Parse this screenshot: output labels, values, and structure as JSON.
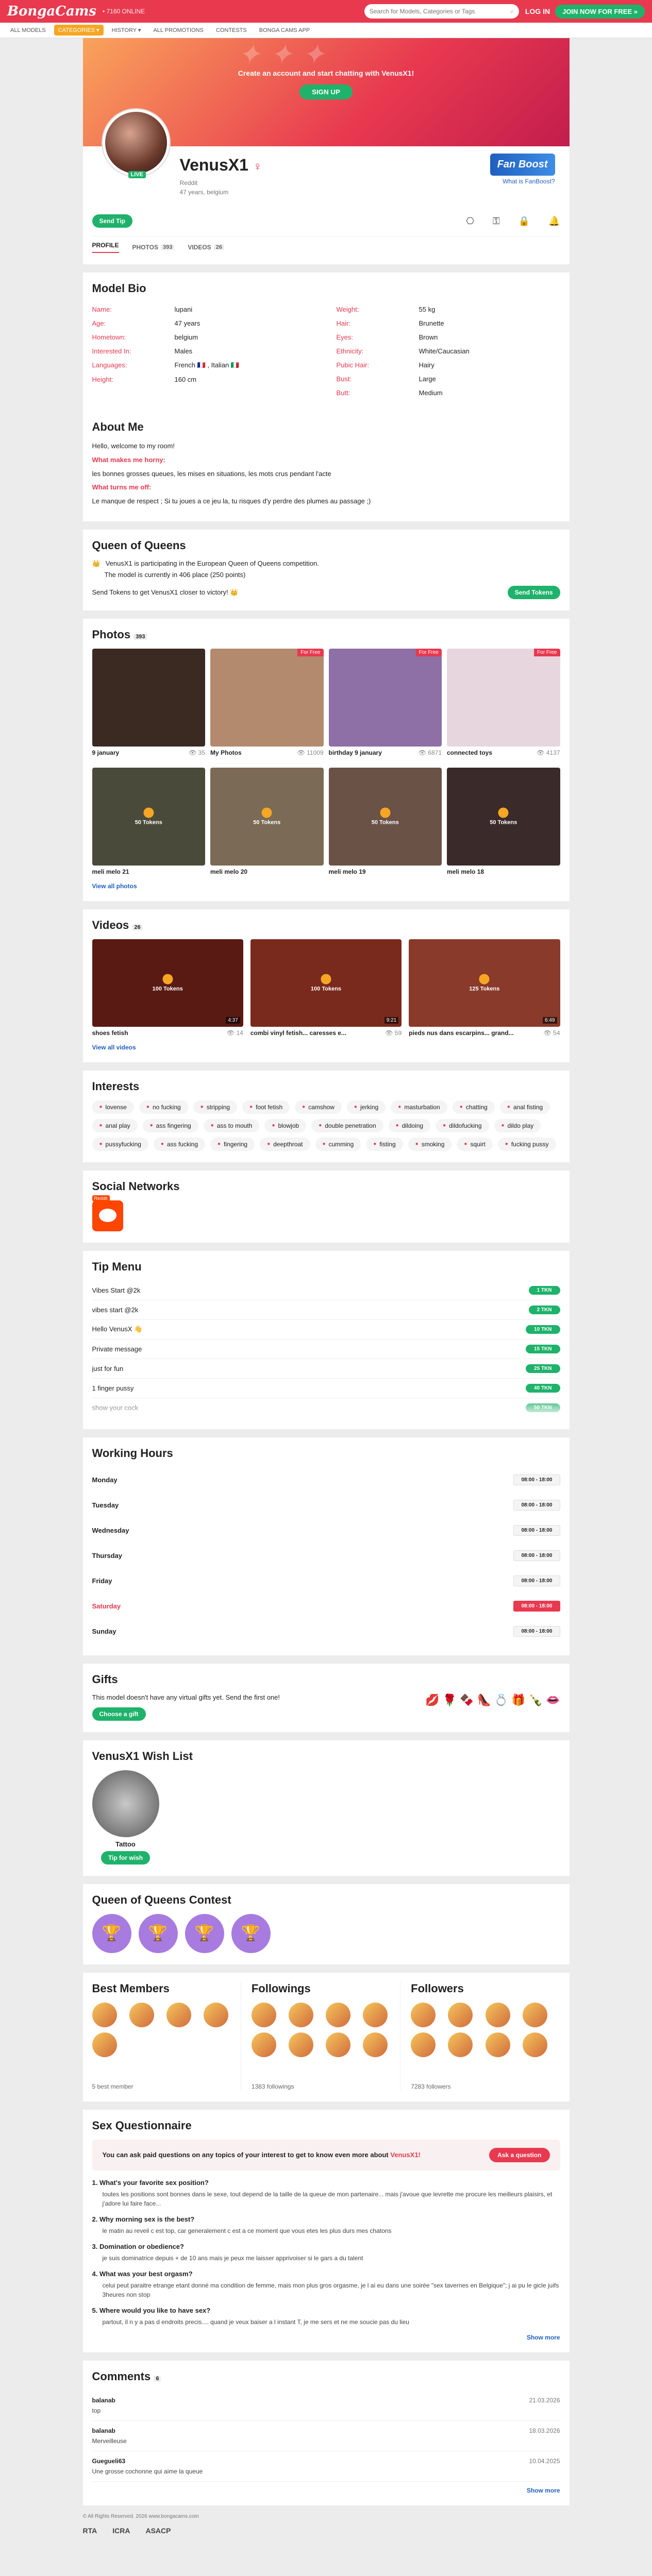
{
  "header": {
    "logo": "BongaCams",
    "online": "• 7160 ONLINE",
    "search_placeholder": "Search for Models, Categories or Tags",
    "login": "LOG IN",
    "join": "JOIN NOW FOR FREE »"
  },
  "nav": [
    "ALL MODELS",
    "CATEGORIES ▾",
    "HISTORY ▾",
    "ALL PROMOTIONS",
    "CONTESTS",
    "BONGA CAMS APP"
  ],
  "banner": {
    "text": "Create an account and start chatting with VenusX1!",
    "signup": "SIGN UP"
  },
  "profile": {
    "name": "VenusX1",
    "sign": "♀",
    "status": "Reddit",
    "meta": "47 years, belgium",
    "live": "LIVE",
    "fanboost": "Fan Boost",
    "fanboost_link": "What is FanBoost?",
    "send_tip": "Send Tip",
    "tabs": [
      {
        "label": "PROFILE",
        "count": ""
      },
      {
        "label": "PHOTOS",
        "count": "393"
      },
      {
        "label": "VIDEOS",
        "count": "26"
      }
    ]
  },
  "bio": {
    "title": "Model Bio",
    "left": [
      {
        "label": "Name:",
        "value": "lupani"
      },
      {
        "label": "Age:",
        "value": "47 years"
      },
      {
        "label": "Hometown:",
        "value": "belgium"
      },
      {
        "label": "Interested In:",
        "value": "Males"
      },
      {
        "label": "Languages:",
        "value": "French 🇫🇷 , Italian 🇮🇹"
      },
      {
        "label": "Height:",
        "value": "160 cm"
      }
    ],
    "right": [
      {
        "label": "Weight:",
        "value": "55 kg"
      },
      {
        "label": "Hair:",
        "value": "Brunette"
      },
      {
        "label": "Eyes:",
        "value": "Brown"
      },
      {
        "label": "Ethnicity:",
        "value": "White/Caucasian"
      },
      {
        "label": "Pubic Hair:",
        "value": "Hairy"
      },
      {
        "label": "Bust:",
        "value": "Large"
      },
      {
        "label": "Butt:",
        "value": "Medium"
      }
    ]
  },
  "about": {
    "title": "About Me",
    "intro": "Hello, welcome to my room!",
    "q1": "What makes me horny:",
    "a1": "les bonnes grosses queues, les mises en situations, les mots crus pendant l'acte",
    "q2": "What turns me off:",
    "a2": "Le manque de respect ; Si tu joues a ce jeu la, tu risques d'y perdre des plumes au passage ;)"
  },
  "qoq": {
    "title": "Queen of Queens",
    "line1": "VenusX1 is participating in the European Queen of Queens competition.",
    "line2": "The model is currently in 406 place (250 points)",
    "foot": "Send Tokens to get VenusX1 closer to victory! 👑",
    "button": "Send Tokens"
  },
  "photos": {
    "title": "Photos",
    "count": "393",
    "view_all": "View all photos",
    "items": [
      {
        "title": "9 january",
        "views": "35",
        "free": "",
        "token": "",
        "color": "#3a2a22"
      },
      {
        "title": "My Photos",
        "views": "11009",
        "free": "For Free",
        "token": "",
        "color": "#b38a6e"
      },
      {
        "title": "birthday 9 january",
        "views": "6871",
        "free": "For Free",
        "token": "",
        "color": "#8e6fa6"
      },
      {
        "title": "connected toys",
        "views": "4137",
        "free": "For Free",
        "token": "",
        "color": "#e7d6de"
      },
      {
        "title": "meli melo 21",
        "views": "",
        "free": "",
        "token": "50 Tokens",
        "color": "#4a4a3a"
      },
      {
        "title": "meli melo 20",
        "views": "",
        "free": "",
        "token": "50 Tokens",
        "color": "#7b6a55"
      },
      {
        "title": "meli melo 19",
        "views": "",
        "free": "",
        "token": "50 Tokens",
        "color": "#6a5247"
      },
      {
        "title": "meli melo 18",
        "views": "",
        "free": "",
        "token": "50 Tokens",
        "color": "#3b2a2a"
      }
    ]
  },
  "videos": {
    "title": "Videos",
    "count": "26",
    "view_all": "View all videos",
    "items": [
      {
        "title": "shoes fetish",
        "views": "14",
        "token": "100 Tokens",
        "dur": "4:37",
        "color": "#5a1a14"
      },
      {
        "title": "combi vinyl fetish... caresses e...",
        "views": "59",
        "token": "100 Tokens",
        "dur": "9:21",
        "color": "#7a2a1c"
      },
      {
        "title": "pieds nus dans escarpins... grand...",
        "views": "54",
        "token": "125 Tokens",
        "dur": "6:49",
        "color": "#8a3a2a"
      }
    ]
  },
  "interests": {
    "title": "Interests",
    "items": [
      "lovense",
      "no fucking",
      "stripping",
      "foot fetish",
      "camshow",
      "jerking",
      "masturbation",
      "chatting",
      "anal fisting",
      "anal play",
      "ass fingering",
      "ass to mouth",
      "blowjob",
      "double penetration",
      "dildoing",
      "dildofucking",
      "dildo play",
      "pussyfucking",
      "ass fucking",
      "fingering",
      "deepthroat",
      "cumming",
      "fisting",
      "smoking",
      "squirt",
      "fucking pussy"
    ]
  },
  "social": {
    "title": "Social Networks",
    "label": "Reddit"
  },
  "tips": {
    "title": "Tip Menu",
    "items": [
      {
        "label": "Vibes Start @2k",
        "price": "1 TKN"
      },
      {
        "label": "vibes start @2k",
        "price": "2 TKN"
      },
      {
        "label": "Hello VenusX 👋",
        "price": "10 TKN"
      },
      {
        "label": "Private message",
        "price": "15 TKN"
      },
      {
        "label": "just for fun",
        "price": "25 TKN"
      },
      {
        "label": "1 finger pussy",
        "price": "40 TKN"
      },
      {
        "label": "show your cock",
        "price": "50 TKN"
      }
    ]
  },
  "hours": {
    "title": "Working Hours",
    "items": [
      {
        "day": "Monday",
        "time": "08:00 - 18:00"
      },
      {
        "day": "Tuesday",
        "time": "08:00 - 18:00"
      },
      {
        "day": "Wednesday",
        "time": "08:00 - 18:00"
      },
      {
        "day": "Thursday",
        "time": "08:00 - 18:00"
      },
      {
        "day": "Friday",
        "time": "08:00 - 18:00"
      },
      {
        "day": "Saturday",
        "time": "08:00 - 18:00"
      },
      {
        "day": "Sunday",
        "time": "08:00 - 18:00"
      }
    ]
  },
  "gifts": {
    "title": "Gifts",
    "text": "This model doesn't have any virtual gifts yet. Send the first one!",
    "button": "Choose a gift",
    "icons": [
      "💋",
      "🌹",
      "🍫",
      "👠",
      "💍",
      "🎁",
      "🍾",
      "👄"
    ]
  },
  "wishlist": {
    "title": "VenusX1 Wish List",
    "item": "Tattoo",
    "button": "Tip for wish"
  },
  "contest": {
    "title": "Queen of Queens Contest"
  },
  "members": {
    "best": {
      "title": "Best Members",
      "foot": "5 best member"
    },
    "followings": {
      "title": "Followings",
      "foot": "1383 followings"
    },
    "followers": {
      "title": "Followers",
      "foot": "7283 followers"
    }
  },
  "questionnaire": {
    "title": "Sex Questionnaire",
    "prompt": "You can ask paid questions on any topics of your interest to get to know even more about",
    "prompt_name": "VenusX1!",
    "button": "Ask a question",
    "items": [
      {
        "q": "1. What's your favorite sex position?",
        "a": "toutes les positions sont bonnes dans le sexe, tout depend de la taille de la queue de mon partenaire... mais j'avoue que levrette me procure les meilleurs plaisirs, et j'adore lui faire face..."
      },
      {
        "q": "2. Why morning sex is the best?",
        "a": "le matin au reveil c est top, car generalement c est a ce moment que vous etes les plus durs mes chatons"
      },
      {
        "q": "3. Domination or obedience?",
        "a": "je suis dominatrice depuis + de 10 ans mais je peux me laisser apprivoiser si le gars a du talent"
      },
      {
        "q": "4. What was your best orgasm?",
        "a": "celui peut paraitre etrange etant donné ma condition de femme, mais mon plus gros orgasme, je l ai eu dans une soirée \"sex tavernes en Belgique\"; j ai pu le gicle juifs 3heures non stop"
      },
      {
        "q": "5. Where would you like to have sex?",
        "a": "partout, il n y a pas d endroits precis.... quand je veux baiser a l instant T, je me sers et ne me soucie pas du lieu"
      }
    ],
    "show_more": "Show more"
  },
  "comments": {
    "title": "Comments",
    "count": "6",
    "items": [
      {
        "user": "balanab",
        "date": "21.03.2026",
        "text": "top"
      },
      {
        "user": "balanab",
        "date": "18.03.2026",
        "text": "Merveilleuse"
      },
      {
        "user": "Guegueli63",
        "date": "10.04.2025",
        "text": "Une grosse cochonne qui aime la queue"
      }
    ],
    "show_more": "Show more"
  },
  "footer": {
    "text": "© All Rights Reserved. 2026 www.bongacams.com",
    "logos": [
      "RTA",
      "ICRA",
      "ASACP"
    ]
  }
}
